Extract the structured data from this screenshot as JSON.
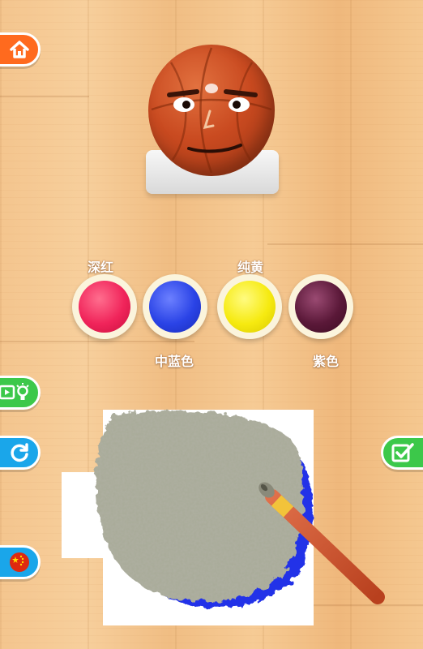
{
  "colors": {
    "deep_red": "#f0245a",
    "mid_blue": "#2a43e6",
    "pure_yellow": "#f6ea10",
    "purple": "#5a1838",
    "paint_gray": "#a9aa98",
    "paint_blue": "#2230e8",
    "home_button": "#ff6a1e",
    "green_button": "#3cc84a",
    "blue_button": "#1aa6ea"
  },
  "palette": [
    {
      "label": "深红",
      "color": "#f0245a",
      "label_position": "above"
    },
    {
      "label": "中蓝色",
      "color": "#2a43e6",
      "label_position": "below"
    },
    {
      "label": "纯黄",
      "color": "#f6ea10",
      "label_position": "above"
    },
    {
      "label": "紫色",
      "color": "#5a1838",
      "label_position": "below"
    }
  ],
  "icons": {
    "home": "home-icon",
    "video_hint": "video-hint-icon",
    "refresh": "refresh-icon",
    "flag": "china-flag-icon",
    "confirm": "checkmark-icon"
  }
}
